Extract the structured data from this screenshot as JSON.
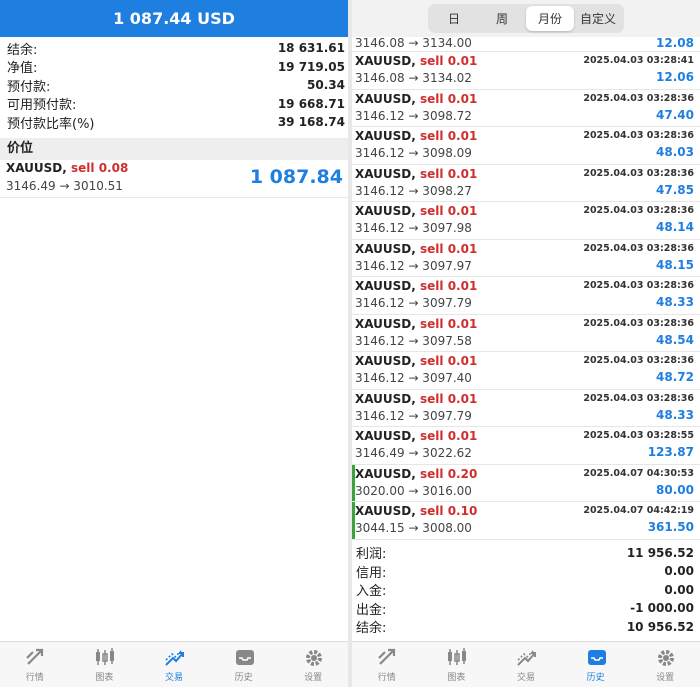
{
  "left": {
    "header_value": "1 087.44 USD",
    "account": [
      {
        "label": "结余:",
        "value": "18 631.61"
      },
      {
        "label": "净值:",
        "value": "19 719.05"
      },
      {
        "label": "预付款:",
        "value": "50.34"
      },
      {
        "label": "可用预付款:",
        "value": "19 668.71"
      },
      {
        "label": "预付款比率(%)",
        "value": "39 168.74"
      }
    ],
    "section_title": "价位",
    "position": {
      "symbol": "XAUUSD,",
      "side": "sell 0.08",
      "prices": "3146.49 → 3010.51",
      "profit": "1 087.84"
    }
  },
  "right": {
    "segments": [
      "日",
      "周",
      "月份",
      "自定义"
    ],
    "active_segment": "月份",
    "first_deal": {
      "prices": "3146.08 → 3134.00",
      "profit": "12.08"
    },
    "deals": [
      {
        "symbol": "XAUUSD,",
        "side": "sell 0.01",
        "time": "2025.04.03 03:28:41",
        "prices": "3146.08 → 3134.02",
        "profit": "12.06"
      },
      {
        "symbol": "XAUUSD,",
        "side": "sell 0.01",
        "time": "2025.04.03 03:28:36",
        "prices": "3146.12 → 3098.72",
        "profit": "47.40"
      },
      {
        "symbol": "XAUUSD,",
        "side": "sell 0.01",
        "time": "2025.04.03 03:28:36",
        "prices": "3146.12 → 3098.09",
        "profit": "48.03"
      },
      {
        "symbol": "XAUUSD,",
        "side": "sell 0.01",
        "time": "2025.04.03 03:28:36",
        "prices": "3146.12 → 3098.27",
        "profit": "47.85"
      },
      {
        "symbol": "XAUUSD,",
        "side": "sell 0.01",
        "time": "2025.04.03 03:28:36",
        "prices": "3146.12 → 3097.98",
        "profit": "48.14"
      },
      {
        "symbol": "XAUUSD,",
        "side": "sell 0.01",
        "time": "2025.04.03 03:28:36",
        "prices": "3146.12 → 3097.97",
        "profit": "48.15"
      },
      {
        "symbol": "XAUUSD,",
        "side": "sell 0.01",
        "time": "2025.04.03 03:28:36",
        "prices": "3146.12 → 3097.79",
        "profit": "48.33"
      },
      {
        "symbol": "XAUUSD,",
        "side": "sell 0.01",
        "time": "2025.04.03 03:28:36",
        "prices": "3146.12 → 3097.58",
        "profit": "48.54"
      },
      {
        "symbol": "XAUUSD,",
        "side": "sell 0.01",
        "time": "2025.04.03 03:28:36",
        "prices": "3146.12 → 3097.40",
        "profit": "48.72"
      },
      {
        "symbol": "XAUUSD,",
        "side": "sell 0.01",
        "time": "2025.04.03 03:28:36",
        "prices": "3146.12 → 3097.79",
        "profit": "48.33"
      },
      {
        "symbol": "XAUUSD,",
        "side": "sell 0.01",
        "time": "2025.04.03 03:28:55",
        "prices": "3146.49 → 3022.62",
        "profit": "123.87"
      },
      {
        "symbol": "XAUUSD,",
        "side": "sell 0.20",
        "time": "2025.04.07 04:30:53",
        "prices": "3020.00 → 3016.00",
        "profit": "80.00",
        "marked": true
      },
      {
        "symbol": "XAUUSD,",
        "side": "sell 0.10",
        "time": "2025.04.07 04:42:19",
        "prices": "3044.15 → 3008.00",
        "profit": "361.50",
        "marked": true
      }
    ],
    "summary": [
      {
        "label": "利润:",
        "value": "11 956.52"
      },
      {
        "label": "信用:",
        "value": "0.00"
      },
      {
        "label": "入金:",
        "value": "0.00"
      },
      {
        "label": "出金:",
        "value": "-1 000.00"
      },
      {
        "label": "结余:",
        "value": "10 956.52"
      }
    ]
  },
  "nav": {
    "left_active": "trade",
    "right_active": "history",
    "items": [
      {
        "id": "quotes",
        "label": "行情",
        "icon": "quotes-icon"
      },
      {
        "id": "chart",
        "label": "图表",
        "icon": "candlestick-chart-icon"
      },
      {
        "id": "trade",
        "label": "交易",
        "icon": "trade-icon"
      },
      {
        "id": "history",
        "label": "历史",
        "icon": "history-inbox-icon"
      },
      {
        "id": "settings",
        "label": "设置",
        "icon": "gear-icon"
      }
    ]
  },
  "colors": {
    "accent": "#1e7fe0",
    "sell": "#d12d2d",
    "marker": "#3aa33a"
  }
}
